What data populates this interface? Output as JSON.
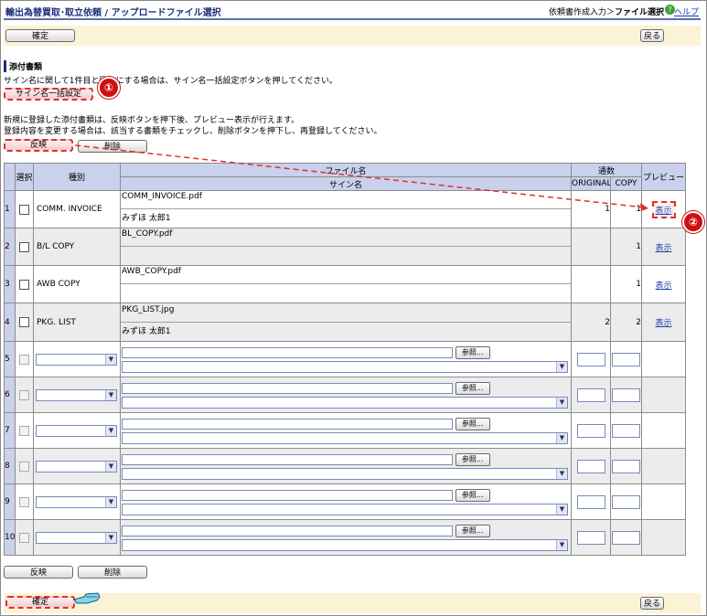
{
  "header": {
    "title": "輸出為替買取･取立依頼 / アップロードファイル選択",
    "breadcrumb_prefix": "依頼書作成入力＞",
    "breadcrumb_current": "ファイル選択",
    "help_icon_glyph": "?",
    "help_label": "ヘルプ"
  },
  "toolbar_top": {
    "confirm_label": "確定",
    "back_label": "戻る"
  },
  "attachments": {
    "section_title": "添付書類",
    "sign_note": "サイン名に関して1件目と同一にする場合は、サイン名一括設定ボタンを押してください。",
    "sign_bulk_label": "サイン名一括設定",
    "note_line1": "新規に登録した添付書類は、反映ボタンを押下後、プレビュー表示が行えます。",
    "note_line2": "登録内容を変更する場合は、該当する書類をチェックし、削除ボタンを押下し、再登録してください。",
    "apply_label": "反映",
    "delete_label": "削除"
  },
  "callouts": {
    "one": "①",
    "two": "②"
  },
  "table": {
    "headers": {
      "select": "選択",
      "type": "種別",
      "file_name": "ファイル名",
      "sign_name": "サイン名",
      "copies": "通数",
      "original": "ORIGINAL",
      "copy": "COPY",
      "preview": "プレビュー"
    },
    "rows": [
      {
        "no": "1",
        "type": "COMM. INVOICE",
        "file": "COMM_INVOICE.pdf",
        "sign": "みずほ 太郎1",
        "original": "1",
        "copy": "1",
        "preview": "表示"
      },
      {
        "no": "2",
        "type": "B/L COPY",
        "file": "BL_COPY.pdf",
        "sign": "",
        "original": "",
        "copy": "1",
        "preview": "表示"
      },
      {
        "no": "3",
        "type": "AWB COPY",
        "file": "AWB_COPY.pdf",
        "sign": "",
        "original": "",
        "copy": "1",
        "preview": "表示"
      },
      {
        "no": "4",
        "type": "PKG. LIST",
        "file": "PKG_LIST.jpg",
        "sign": "みずほ 太郎1",
        "original": "2",
        "copy": "2",
        "preview": "表示"
      }
    ],
    "empty_rows": [
      {
        "no": "5",
        "browse": "参照..."
      },
      {
        "no": "6",
        "browse": "参照..."
      },
      {
        "no": "7",
        "browse": "参照..."
      },
      {
        "no": "8",
        "browse": "参照..."
      },
      {
        "no": "9",
        "browse": "参照..."
      },
      {
        "no": "10",
        "browse": "参照..."
      }
    ]
  },
  "bottom_actions": {
    "apply_label": "反映",
    "delete_label": "削除"
  },
  "toolbar_bottom": {
    "confirm_label": "確定",
    "back_label": "戻る"
  },
  "colors": {
    "header_bg": "#c9d1ec",
    "bar_bg": "#faf3d6",
    "highlight": "#e03030",
    "badge": "#cc1111",
    "title": "#1c2f7a"
  }
}
